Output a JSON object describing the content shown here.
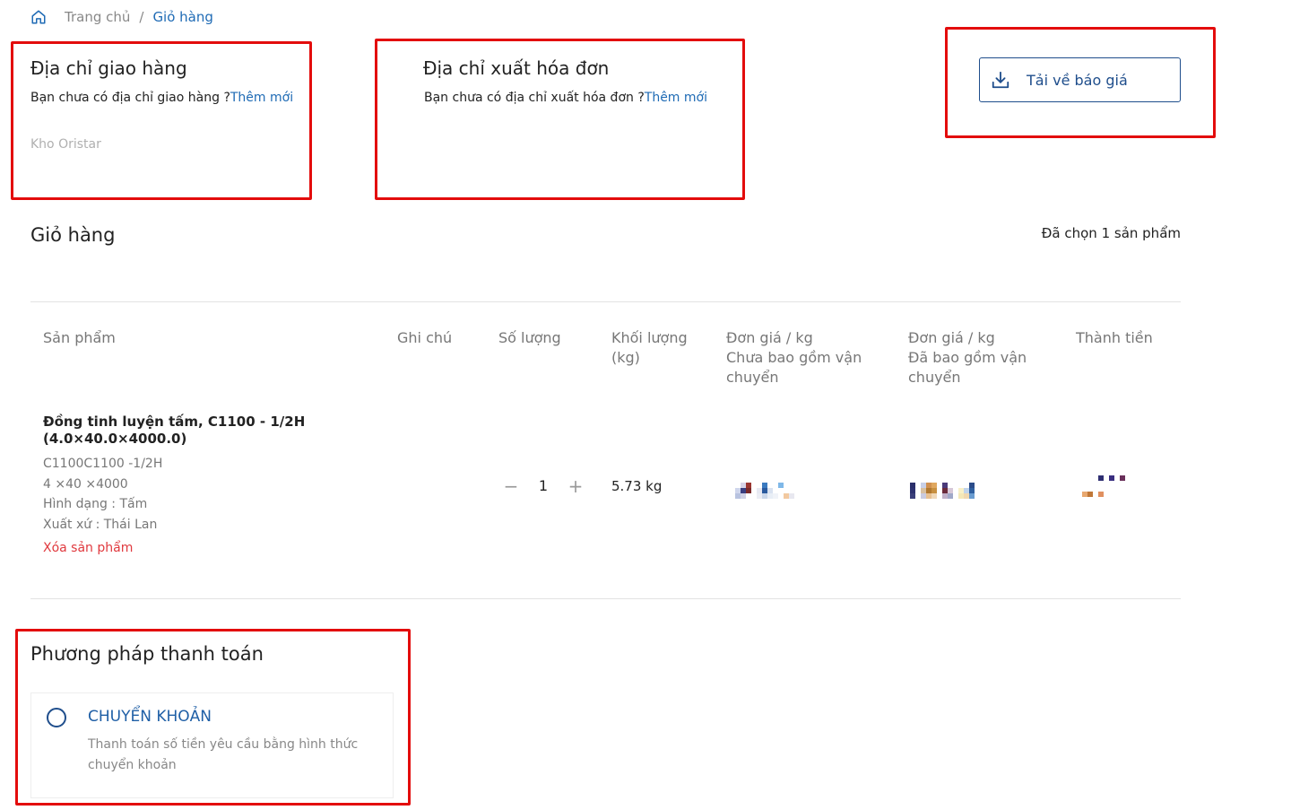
{
  "breadcrumb": {
    "home_icon": "home-icon",
    "home": "Trang chủ",
    "separator": "/",
    "current": "Giỏ hàng"
  },
  "shipping": {
    "title": "Địa chỉ giao hàng",
    "empty_text": "Bạn chưa có địa chỉ giao hàng ?",
    "add_link": "Thêm mới",
    "warehouse_placeholder": "Kho Oristar"
  },
  "invoice": {
    "title": "Địa chỉ xuất hóa đơn",
    "empty_text": "Bạn chưa có địa chỉ xuất hóa đơn ?",
    "add_link": "Thêm mới"
  },
  "download": {
    "icon": "download-icon",
    "label": "Tải về báo giá"
  },
  "cart": {
    "title": "Giỏ hàng",
    "selected": "Đã chọn 1 sản phẩm",
    "columns": {
      "product": "Sản phẩm",
      "note": "Ghi chú",
      "quantity": "Số lượng",
      "weight_line1": "Khối lượng",
      "weight_line2": "(kg)",
      "price_excl_line1": "Đơn giá / kg",
      "price_excl_line2": "Chưa bao gồm vận",
      "price_excl_line3": "chuyển",
      "price_incl_line1": "Đơn giá / kg",
      "price_incl_line2": "Đã bao gồm vận",
      "price_incl_line3": "chuyển",
      "total": "Thành tiền"
    },
    "item": {
      "name_line1": "Đồng tinh luyện tấm, C1100 - 1/2H",
      "name_line2": "(4.0×40.0×4000.0)",
      "code": "C1100C1100 -1/2H",
      "size": "4 ×40 ×4000",
      "shape": "Hình dạng : Tấm",
      "origin": "Xuất xứ : Thái Lan",
      "delete": "Xóa sản phẩm",
      "minus": "−",
      "quantity": "1",
      "plus": "+",
      "weight": "5.73 kg"
    }
  },
  "payment": {
    "title": "Phương pháp thanh toán",
    "option_label": "CHUYỂN KHOẢN",
    "option_desc": "Thanh toán số tiền yêu cầu bằng hình thức chuyển khoản"
  },
  "colors": {
    "annotation_red": "#e30c0c",
    "link_blue": "#1f6bb5",
    "brand_navy": "#1f4e8c",
    "danger_red": "#e0393e"
  }
}
